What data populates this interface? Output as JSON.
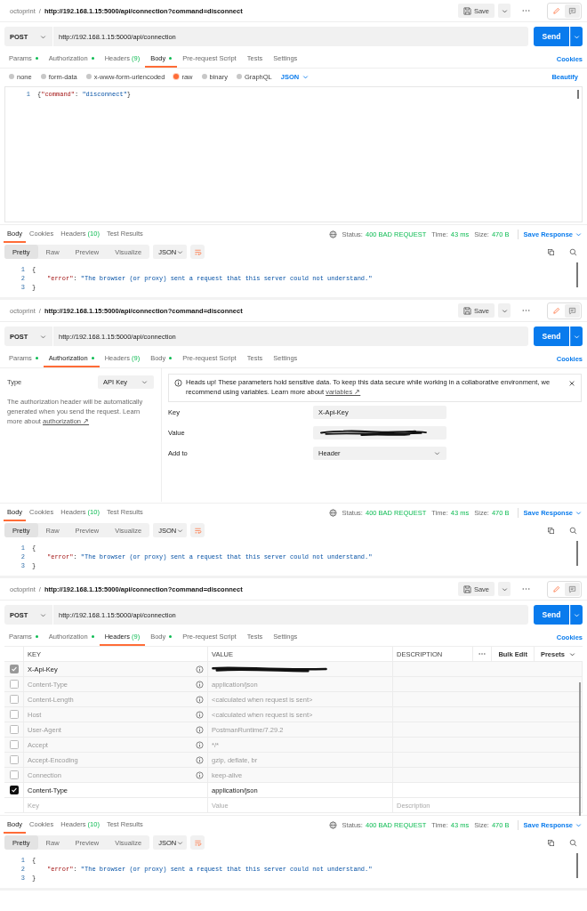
{
  "panels": [
    {
      "breadcrumb": {
        "collection": "octoprint",
        "separator": "/",
        "name": "http://192.168.1.15:5000/api/connection?command=disconnect"
      },
      "save": "Save",
      "edit_mode": true,
      "method": "POST",
      "url": "http://192.168.1.15:5000/api/connection",
      "send": "Send",
      "tabs": [
        {
          "label": "Params",
          "dot": true,
          "selected": false
        },
        {
          "label": "Authorization",
          "dot": true,
          "selected": false
        },
        {
          "label": "Headers",
          "count": "(9)",
          "dot": false,
          "selected": false
        },
        {
          "label": "Body",
          "dot": true,
          "selected": true
        },
        {
          "label": "Pre-request Script",
          "dot": false,
          "selected": false
        },
        {
          "label": "Tests",
          "dot": false,
          "selected": false
        },
        {
          "label": "Settings",
          "dot": false,
          "selected": false
        }
      ],
      "cookies": "Cookies",
      "request": {
        "kind": "body",
        "modes": [
          {
            "label": "none",
            "selected": false
          },
          {
            "label": "form-data",
            "selected": false
          },
          {
            "label": "x-www-form-urlencoded",
            "selected": false
          },
          {
            "label": "raw",
            "selected": true
          },
          {
            "label": "binary",
            "selected": false
          },
          {
            "label": "GraphQL",
            "selected": false
          }
        ],
        "format": "JSON",
        "beautify": "Beautify",
        "lines": [
          {
            "no": "1",
            "indent": false,
            "tokens": [
              {
                "kind": "punct",
                "text": "{"
              },
              {
                "kind": "key",
                "text": "\"command\""
              },
              {
                "kind": "punct",
                "text": ": "
              },
              {
                "kind": "string",
                "text": "\"disconnect\""
              },
              {
                "kind": "punct",
                "text": "}"
              }
            ]
          }
        ]
      },
      "response": {
        "tabs": [
          {
            "label": "Body",
            "selected": true
          },
          {
            "label": "Cookies",
            "selected": false
          },
          {
            "label": "Headers",
            "count": "(10)",
            "selected": false
          },
          {
            "label": "Test Results",
            "selected": false
          }
        ],
        "status_label": "Status:",
        "status": "400 BAD REQUEST",
        "time_label": "Time:",
        "time": "43 ms",
        "size_label": "Size:",
        "size": "470 B",
        "save": "Save Response",
        "views": [
          {
            "label": "Pretty",
            "selected": true
          },
          {
            "label": "Raw",
            "selected": false
          },
          {
            "label": "Preview",
            "selected": false
          },
          {
            "label": "Visualize",
            "selected": false
          }
        ],
        "format": "JSON",
        "lines": [
          {
            "no": "1",
            "indent": false,
            "tokens": [
              {
                "kind": "punct",
                "text": "{"
              }
            ]
          },
          {
            "no": "2",
            "indent": true,
            "tokens": [
              {
                "kind": "key",
                "text": "\"error\""
              },
              {
                "kind": "punct",
                "text": ": "
              },
              {
                "kind": "string",
                "text": "\"The browser (or proxy) sent a request that this server could not understand.\""
              }
            ]
          },
          {
            "no": "3",
            "indent": false,
            "tokens": [
              {
                "kind": "punct",
                "text": "}"
              }
            ]
          }
        ]
      }
    },
    {
      "breadcrumb": {
        "collection": "octoprint",
        "separator": "/",
        "name": "http://192.168.1.15:5000/api/connection?command=disconnect"
      },
      "save": "Save",
      "edit_mode": true,
      "method": "POST",
      "url": "http://192.168.1.15:5000/api/connection",
      "send": "Send",
      "tabs": [
        {
          "label": "Params",
          "dot": true,
          "selected": false
        },
        {
          "label": "Authorization",
          "dot": true,
          "selected": true
        },
        {
          "label": "Headers",
          "count": "(9)",
          "dot": false,
          "selected": false
        },
        {
          "label": "Body",
          "dot": true,
          "selected": false
        },
        {
          "label": "Pre-request Script",
          "dot": false,
          "selected": false
        },
        {
          "label": "Tests",
          "dot": false,
          "selected": false
        },
        {
          "label": "Settings",
          "dot": false,
          "selected": false
        }
      ],
      "cookies": "Cookies",
      "request": {
        "kind": "auth",
        "type_label": "Type",
        "type_value": "API Key",
        "description": "The authorization header will be automatically generated when you send the request. Learn more about",
        "description_link": "authorization ↗",
        "alert": "Heads up! These parameters hold sensitive data. To keep this data secure while working in a collaborative environment, we recommend using variables. Learn more about",
        "alert_link": "variables ↗",
        "fields": [
          {
            "kind": "text",
            "label": "Key",
            "value": "X-Api-Key"
          },
          {
            "kind": "redacted",
            "label": "Value"
          },
          {
            "kind": "select",
            "label": "Add to",
            "value": "Header"
          }
        ]
      },
      "response": {
        "tabs": [
          {
            "label": "Body",
            "selected": true
          },
          {
            "label": "Cookies",
            "selected": false
          },
          {
            "label": "Headers",
            "count": "(10)",
            "selected": false
          },
          {
            "label": "Test Results",
            "selected": false
          }
        ],
        "status_label": "Status:",
        "status": "400 BAD REQUEST",
        "time_label": "Time:",
        "time": "43 ms",
        "size_label": "Size:",
        "size": "470 B",
        "save": "Save Response",
        "views": [
          {
            "label": "Pretty",
            "selected": true
          },
          {
            "label": "Raw",
            "selected": false
          },
          {
            "label": "Preview",
            "selected": false
          },
          {
            "label": "Visualize",
            "selected": false
          }
        ],
        "format": "JSON",
        "lines": [
          {
            "no": "1",
            "indent": false,
            "tokens": [
              {
                "kind": "punct",
                "text": "{"
              }
            ]
          },
          {
            "no": "2",
            "indent": true,
            "tokens": [
              {
                "kind": "key",
                "text": "\"error\""
              },
              {
                "kind": "punct",
                "text": ": "
              },
              {
                "kind": "string",
                "text": "\"The browser (or proxy) sent a request that this server could not understand.\""
              }
            ]
          },
          {
            "no": "3",
            "indent": false,
            "tokens": [
              {
                "kind": "punct",
                "text": "}"
              }
            ]
          }
        ]
      }
    },
    {
      "breadcrumb": {
        "collection": "octoprint",
        "separator": "/",
        "name": "http://192.168.1.15:5000/api/connection?command=disconnect"
      },
      "save": "Save",
      "edit_mode": true,
      "method": "POST",
      "url": "http://192.168.1.15:5000/api/connection",
      "send": "Send",
      "tabs": [
        {
          "label": "Params",
          "dot": true,
          "selected": false
        },
        {
          "label": "Authorization",
          "dot": true,
          "selected": false
        },
        {
          "label": "Headers",
          "count": "(9)",
          "dot": false,
          "selected": true
        },
        {
          "label": "Body",
          "dot": true,
          "selected": false
        },
        {
          "label": "Pre-request Script",
          "dot": false,
          "selected": false
        },
        {
          "label": "Tests",
          "dot": false,
          "selected": false
        },
        {
          "label": "Settings",
          "dot": false,
          "selected": false
        }
      ],
      "cookies": "Cookies",
      "request": {
        "kind": "headers",
        "columns": [
          "KEY",
          "VALUE",
          "DESCRIPTION"
        ],
        "bulk_edit": "Bulk Edit",
        "presets": "Presets",
        "rows": [
          {
            "key": "X-Api-Key",
            "redacted": true,
            "checked": true,
            "auto": true
          },
          {
            "key": "Content-Type",
            "value": "application/json",
            "checked": false,
            "auto": true
          },
          {
            "key": "Content-Length",
            "value": "<calculated when request is sent>",
            "checked": false,
            "auto": true
          },
          {
            "key": "Host",
            "value": "<calculated when request is sent>",
            "checked": false,
            "auto": true
          },
          {
            "key": "User-Agent",
            "value": "PostmanRuntime/7.29.2",
            "checked": false,
            "auto": true
          },
          {
            "key": "Accept",
            "value": "*/*",
            "checked": false,
            "auto": true
          },
          {
            "key": "Accept-Encoding",
            "value": "gzip, deflate, br",
            "checked": false,
            "auto": true
          },
          {
            "key": "Connection",
            "value": "keep-alive",
            "checked": false,
            "auto": true
          },
          {
            "key": "Content-Type",
            "value": "application/json",
            "checked": true,
            "auto": false
          }
        ],
        "new_row": {
          "key": "Key",
          "value": "Value",
          "description": "Description"
        }
      },
      "response": {
        "tabs": [
          {
            "label": "Body",
            "selected": true
          },
          {
            "label": "Cookies",
            "selected": false
          },
          {
            "label": "Headers",
            "count": "(10)",
            "selected": false
          },
          {
            "label": "Test Results",
            "selected": false
          }
        ],
        "status_label": "Status:",
        "status": "400 BAD REQUEST",
        "time_label": "Time:",
        "time": "43 ms",
        "size_label": "Size:",
        "size": "470 B",
        "save": "Save Response",
        "views": [
          {
            "label": "Pretty",
            "selected": true
          },
          {
            "label": "Raw",
            "selected": false
          },
          {
            "label": "Preview",
            "selected": false
          },
          {
            "label": "Visualize",
            "selected": false
          }
        ],
        "format": "JSON",
        "lines": [
          {
            "no": "1",
            "indent": false,
            "tokens": [
              {
                "kind": "punct",
                "text": "{"
              }
            ]
          },
          {
            "no": "2",
            "indent": true,
            "tokens": [
              {
                "kind": "key",
                "text": "\"error\""
              },
              {
                "kind": "punct",
                "text": ": "
              },
              {
                "kind": "string",
                "text": "\"The browser (or proxy) sent a request that this server could not understand.\""
              }
            ]
          },
          {
            "no": "3",
            "indent": false,
            "tokens": [
              {
                "kind": "punct",
                "text": "}"
              }
            ]
          }
        ]
      }
    }
  ]
}
